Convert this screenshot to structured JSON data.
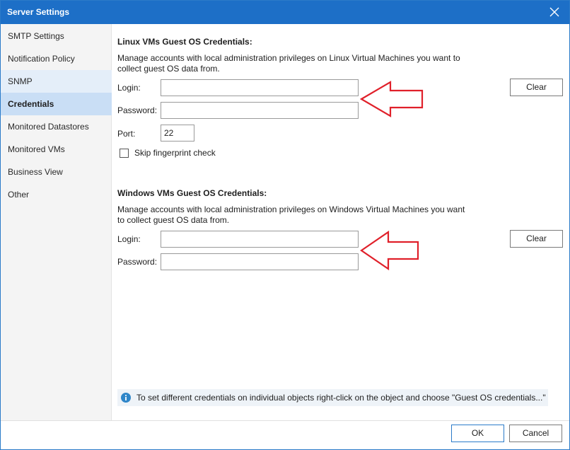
{
  "window": {
    "title": "Server Settings"
  },
  "sidebar": {
    "items": [
      {
        "label": "SMTP Settings"
      },
      {
        "label": "Notification Policy"
      },
      {
        "label": "SNMP"
      },
      {
        "label": "Credentials"
      },
      {
        "label": "Monitored Datastores"
      },
      {
        "label": "Monitored VMs"
      },
      {
        "label": "Business View"
      },
      {
        "label": "Other"
      }
    ],
    "active_item": "Credentials"
  },
  "linux": {
    "title": "Linux VMs Guest OS Credentials:",
    "description": "Manage accounts with local administration privileges on Linux Virtual Machines you want to collect guest OS data from.",
    "login_label": "Login:",
    "login_value": "",
    "password_label": "Password:",
    "password_value": "",
    "port_label": "Port:",
    "port_value": "22",
    "skip_fingerprint_label": "Skip fingerprint check",
    "skip_fingerprint_checked": false,
    "clear_label": "Clear"
  },
  "windows": {
    "title": "Windows VMs Guest OS Credentials:",
    "description": "Manage accounts with local administration privileges on Windows Virtual Machines you want to collect guest OS data from.",
    "login_label": "Login:",
    "login_value": "",
    "password_label": "Password:",
    "password_value": "",
    "clear_label": "Clear"
  },
  "info": {
    "text": "To set different credentials on individual objects right-click on the object and choose \"Guest OS credentials...\""
  },
  "footer": {
    "ok_label": "OK",
    "cancel_label": "Cancel"
  },
  "colors": {
    "titlebar": "#1d6fc7",
    "active_item": "#c9def5",
    "annotation_arrow": "#e0202a",
    "info_icon": "#2f86c9"
  },
  "icons": {
    "close": "close-icon",
    "info": "info-icon",
    "annotation": "red-arrow-annotation"
  }
}
